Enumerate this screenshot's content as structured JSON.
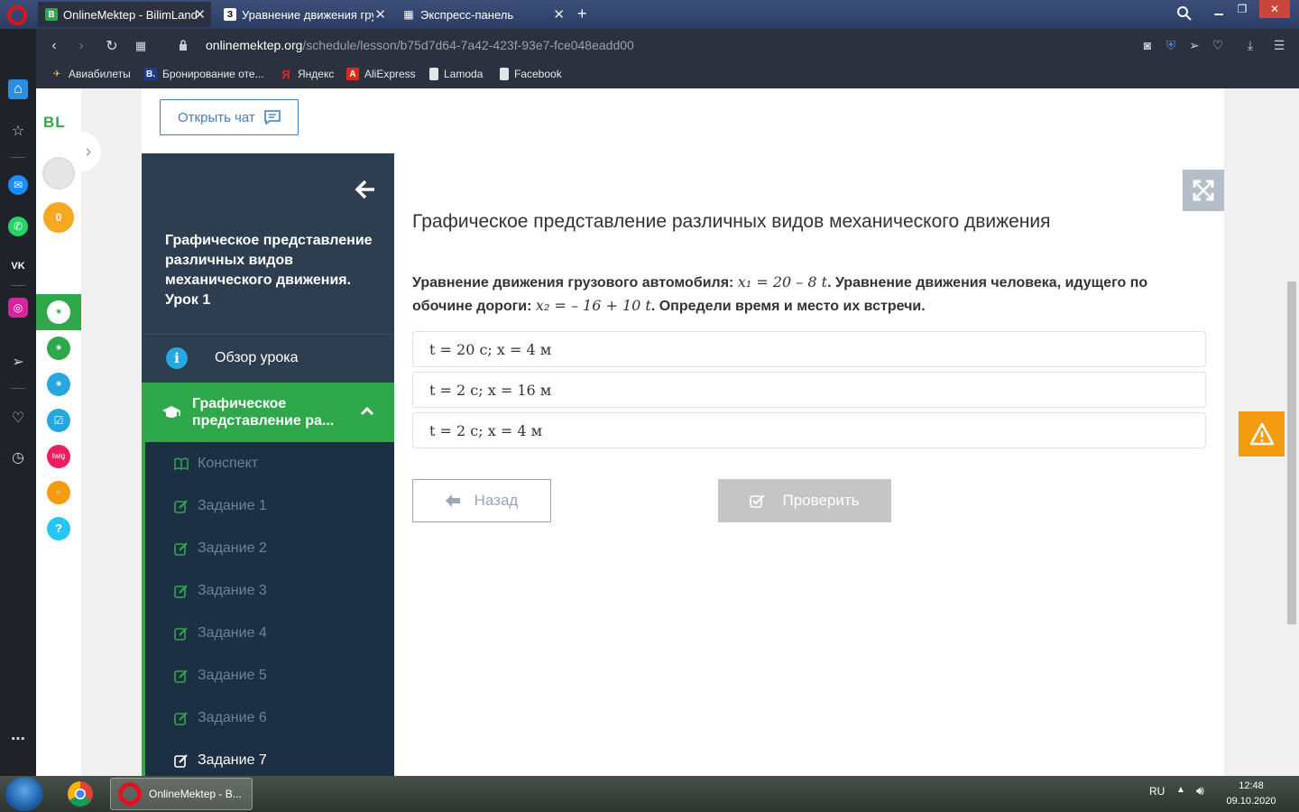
{
  "browser": {
    "tabs": [
      {
        "title": "OnlineMektep - BilimLand",
        "favicon": "B",
        "active": true
      },
      {
        "title": "Уравнение движения грузового",
        "favicon": "З",
        "active": false
      },
      {
        "title": "Экспресс-панель",
        "favicon": "▦",
        "active": false
      }
    ],
    "new_tab": "+",
    "url_domain": "onlinemektep.org",
    "url_path": "/schedule/lesson/b75d7d64-7a42-423f-93e7-fce048eadd00",
    "bookmarks": [
      {
        "label": "Авиабилеты",
        "icon": "plane-icon"
      },
      {
        "label": "Бронирование оте...",
        "icon": "booking-icon"
      },
      {
        "label": "Яндекс",
        "icon": "yandex-icon"
      },
      {
        "label": "AliExpress",
        "icon": "aliexpress-icon"
      },
      {
        "label": "Lamoda",
        "icon": "page-icon"
      },
      {
        "label": "Facebook",
        "icon": "page-icon"
      }
    ]
  },
  "bl_sidebar": {
    "logo": "BL",
    "coins": "0"
  },
  "page": {
    "chat_button": "Открыть чат",
    "lesson_title": "Графическое представление различных видов механического движения. Урок 1",
    "overview_label": "Обзор урока",
    "current_section": "Графическое представление ра...",
    "sub_items": [
      {
        "label": "Конспект",
        "icon": "book-icon",
        "active": false
      },
      {
        "label": "Задание 1",
        "icon": "edit-icon",
        "active": false
      },
      {
        "label": "Задание 2",
        "icon": "edit-icon",
        "active": false
      },
      {
        "label": "Задание 3",
        "icon": "edit-icon",
        "active": false
      },
      {
        "label": "Задание 4",
        "icon": "edit-icon",
        "active": false
      },
      {
        "label": "Задание 5",
        "icon": "edit-icon",
        "active": false
      },
      {
        "label": "Задание 6",
        "icon": "edit-icon",
        "active": false
      },
      {
        "label": "Задание 7",
        "icon": "edit-icon",
        "active": true
      }
    ],
    "content_title": "Графическое представление различных видов механического движения",
    "question": {
      "part1": "Уравнение движения грузового автомобиля: ",
      "eq1": "x₁ = 20 – 8 t",
      "part2": ". Уравнение движения человека, идущего по обочине дороги: ",
      "eq2": "x₂ = – 16 + 10 t",
      "part3": ". Определи время и место их встречи."
    },
    "options": [
      "t = 20 с; x = 4 м",
      "t = 2 с; x = 16 м",
      "t = 2 с; x = 4 м"
    ],
    "back_button": "Назад",
    "check_button": "Проверить"
  },
  "taskbar": {
    "active_app": "OnlineMektep - B...",
    "lang": "RU",
    "time": "12:48",
    "date": "09.10.2020"
  },
  "colors": {
    "accent_green": "#2ea84a",
    "nav_dark": "#2c3e50",
    "link_blue": "#3f7fc2",
    "warning": "#f39c12"
  }
}
